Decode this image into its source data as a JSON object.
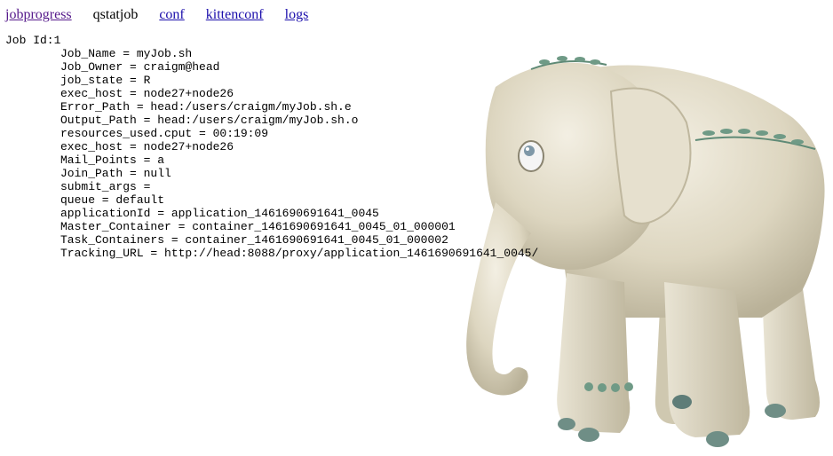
{
  "nav": {
    "items": [
      {
        "label": "jobprogress",
        "link": true,
        "visited": true
      },
      {
        "label": "qstatjob",
        "link": false,
        "visited": false
      },
      {
        "label": "conf",
        "link": true,
        "visited": false
      },
      {
        "label": "kittenconf",
        "link": true,
        "visited": false
      },
      {
        "label": "logs",
        "link": true,
        "visited": false
      }
    ]
  },
  "job": {
    "header": "Job Id:1",
    "fields": [
      "Job_Name = myJob.sh",
      "Job_Owner = craigm@head",
      "job_state = R",
      "exec_host = node27+node26",
      "Error_Path = head:/users/craigm/myJob.sh.e",
      "Output_Path = head:/users/craigm/myJob.sh.o",
      "resources_used.cput = 00:19:09",
      "exec_host = node27+node26",
      "Mail_Points = a",
      "Join_Path = null",
      "submit_args =",
      "queue = default",
      "applicationId = application_1461690691641_0045",
      "Master_Container = container_1461690691641_0045_01_000001",
      "Task_Containers = container_1461690691641_0045_01_000002",
      "Tracking_URL = http://head:8088/proxy/application_1461690691641_0045/"
    ]
  },
  "colors": {
    "link": "#1a0dab",
    "visited_link": "#551a8b",
    "elephant_body": "#ddd6c0",
    "ornament": "#5f8a76"
  },
  "icons": [
    "elephant-illustration"
  ]
}
